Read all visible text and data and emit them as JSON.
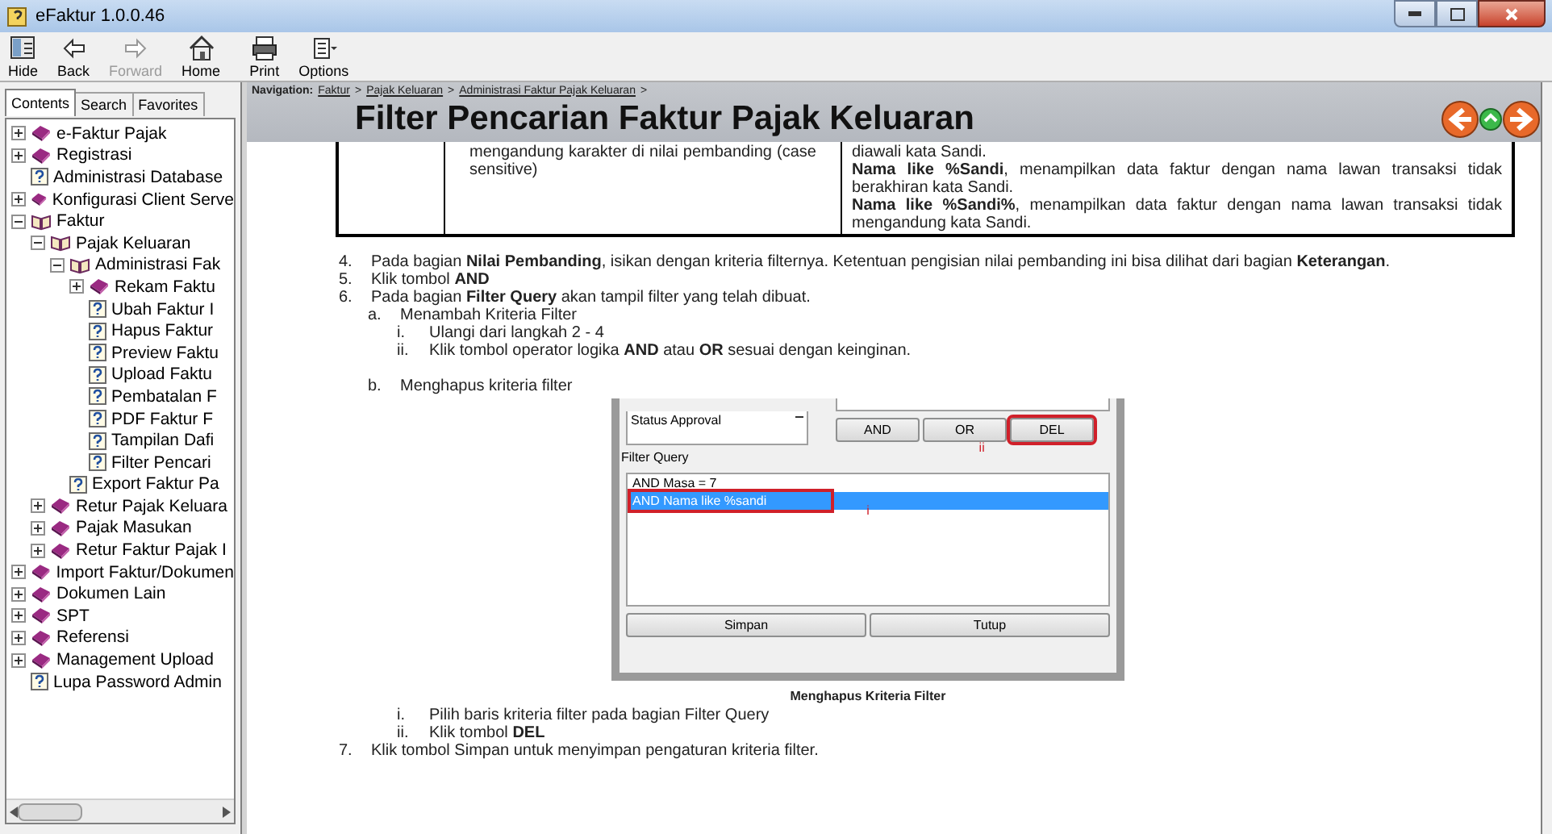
{
  "window": {
    "title": "eFaktur 1.0.0.46"
  },
  "toolbar": [
    {
      "label": "Hide",
      "kind": "hide",
      "disabled": false
    },
    {
      "label": "Back",
      "kind": "back",
      "disabled": false
    },
    {
      "label": "Forward",
      "kind": "forward",
      "disabled": true
    },
    {
      "label": "Home",
      "kind": "home",
      "disabled": false
    },
    {
      "label": "Print",
      "kind": "print",
      "disabled": false
    },
    {
      "label": "Options",
      "kind": "options",
      "disabled": false
    }
  ],
  "tabs": [
    {
      "label": "Contents",
      "selected": true
    },
    {
      "label": "Search",
      "selected": false
    },
    {
      "label": "Favorites",
      "selected": false
    }
  ],
  "tree": [
    {
      "label": "e-Faktur Pajak",
      "kind": "book",
      "expanded": false
    },
    {
      "label": "Registrasi",
      "kind": "book",
      "expanded": false
    },
    {
      "label": "Administrasi Database",
      "kind": "page"
    },
    {
      "label": "Konfigurasi Client Serve",
      "kind": "book",
      "expanded": false
    },
    {
      "label": "Faktur",
      "kind": "open_book",
      "expanded": true,
      "children": [
        {
          "label": "Pajak Keluaran",
          "kind": "open_book",
          "expanded": true,
          "children": [
            {
              "label": "Administrasi Fak",
              "kind": "open_book",
              "expanded": true,
              "children": [
                {
                  "label": "Rekam Faktu",
                  "kind": "book",
                  "expanded": false
                },
                {
                  "label": "Ubah Faktur I",
                  "kind": "page"
                },
                {
                  "label": "Hapus Faktur",
                  "kind": "page"
                },
                {
                  "label": "Preview Faktu",
                  "kind": "page"
                },
                {
                  "label": "Upload Faktu",
                  "kind": "page"
                },
                {
                  "label": "Pembatalan F",
                  "kind": "page"
                },
                {
                  "label": "PDF Faktur F",
                  "kind": "page"
                },
                {
                  "label": "Tampilan Dafi",
                  "kind": "page"
                },
                {
                  "label": "Filter Pencari",
                  "kind": "page"
                }
              ]
            },
            {
              "label": "Export Faktur Pa",
              "kind": "page"
            }
          ]
        },
        {
          "label": "Retur Pajak Keluara",
          "kind": "book",
          "expanded": false
        },
        {
          "label": "Pajak Masukan",
          "kind": "book",
          "expanded": false
        },
        {
          "label": "Retur Faktur Pajak I",
          "kind": "book",
          "expanded": false
        }
      ]
    },
    {
      "label": "Import Faktur/Dokumen",
      "kind": "book",
      "expanded": false
    },
    {
      "label": "Dokumen Lain",
      "kind": "book",
      "expanded": false
    },
    {
      "label": "SPT",
      "kind": "book",
      "expanded": false
    },
    {
      "label": "Referensi",
      "kind": "book",
      "expanded": false
    },
    {
      "label": "Management Upload",
      "kind": "book",
      "expanded": false
    },
    {
      "label": "Lupa Password Admin",
      "kind": "page"
    }
  ],
  "navigation": {
    "label": "Navigation:",
    "separator": ">",
    "links": [
      "Faktur",
      "Pajak Keluaran",
      "Administrasi Faktur Pajak Keluaran"
    ]
  },
  "title": "Filter Pencarian Faktur Pajak Keluaran",
  "table_row": {
    "column_2": "mengandung karakter di nilai pembanding (case sensitive)",
    "column_3": [
      "diawali kata Sandi.",
      "**Nama like %Sandi**, menampilkan data faktur dengan nama lawan transaksi tidak berakhiran kata Sandi.",
      "**Nama like %Sandi%**, menampilkan data faktur dengan nama lawan transaksi tidak mengandung kata Sandi."
    ]
  },
  "steps": [
    {
      "marker": "4.",
      "text": "Pada bagian **Nilai Pembanding**, isikan dengan kriteria filternya. Ketentuan pengisian nilai pembanding ini bisa dilihat dari bagian **Keterangan**."
    },
    {
      "marker": "5.",
      "text": "Klik tombol **AND**"
    },
    {
      "marker": "6.",
      "text": "Pada bagian **Filter Query** akan tampil filter yang telah dibuat.",
      "children": [
        {
          "marker": "a.",
          "text": "Menambah Kriteria Filter",
          "children": [
            {
              "marker": "i.",
              "text": "Ulangi dari langkah 2 - 4"
            },
            {
              "marker": "ii.",
              "text": "Klik tombol operator logika **AND** atau **OR** sesuai dengan keinginan."
            }
          ]
        },
        {
          "marker": "b.",
          "text": "Menghapus kriteria filter",
          "figure": {
            "field_list": [
              "Status Approval"
            ],
            "operator_buttons": [
              {
                "label": "AND",
                "marked": false
              },
              {
                "label": "OR",
                "marked": false
              },
              {
                "label": "DEL",
                "marked": true
              }
            ],
            "button_callout": "ii",
            "query_label": "Filter Query",
            "query_rows": [
              {
                "text": "AND Masa = 7",
                "selected": false,
                "marked": false
              },
              {
                "text": "AND Nama like %sandi",
                "selected": true,
                "marked": true
              }
            ],
            "row_callout": "i",
            "bottom_buttons": [
              "Simpan",
              "Tutup"
            ],
            "caption": "Menghapus Kriteria Filter"
          },
          "children": [
            {
              "marker": "i.",
              "text": "Pilih baris kriteria filter pada bagian Filter Query"
            },
            {
              "marker": "ii.",
              "text": "Klik tombol **DEL**"
            }
          ]
        }
      ]
    },
    {
      "marker": "7.",
      "text": "Klik tombol Simpan untuk menyimpan pengaturan kriteria filter."
    }
  ]
}
